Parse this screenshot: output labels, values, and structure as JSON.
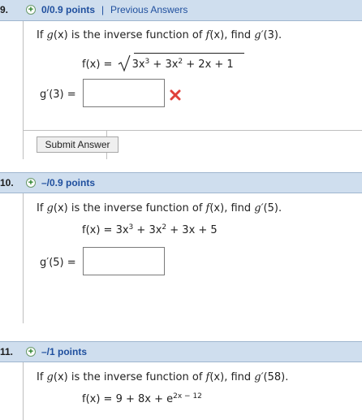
{
  "questions": [
    {
      "number": "9.",
      "points": "0/0.9 points",
      "separator": "|",
      "previous_answers": "Previous Answers",
      "prompt": {
        "pre": "If ",
        "g": "g",
        "x1": "(x)",
        "mid": " is the inverse function of ",
        "f": "f",
        "x2": "(x)",
        "find": ", find ",
        "gp": "g′",
        "arg": "(3)."
      },
      "formula": {
        "lhs": "f(x) = ",
        "t1": "3x",
        "e1": "3",
        "t2": " + 3x",
        "e2": "2",
        "t3": " + 2x + 1"
      },
      "answer_label": "g′(3) =",
      "answer_value": "",
      "status": "incorrect",
      "submit_label": "Submit Answer"
    },
    {
      "number": "10.",
      "points": "–/0.9 points",
      "prompt": {
        "pre": "If ",
        "g": "g",
        "x1": "(x)",
        "mid": " is the inverse function of ",
        "f": "f",
        "x2": "(x)",
        "find": ", find ",
        "gp": "g′",
        "arg": "(5)."
      },
      "formula": {
        "lhs": "f(x) = ",
        "t1": "3x",
        "e1": "3",
        "t2": " + 3x",
        "e2": "2",
        "t3": " + 3x + 5"
      },
      "answer_label": "g′(5) =",
      "answer_value": ""
    },
    {
      "number": "11.",
      "points": "–/1 points",
      "prompt": {
        "pre": "If ",
        "g": "g",
        "x1": "(x)",
        "mid": " is the inverse function of ",
        "f": "f",
        "x2": "(x)",
        "find": ", find ",
        "gp": "g′",
        "arg": "(58)."
      },
      "formula": {
        "lhs": "f(x) = ",
        "t1": "9 + 8x + e",
        "e1": "2x − 12"
      }
    }
  ],
  "colors": {
    "header_bg": "#cfdeee",
    "link": "#1f4f9e",
    "error": "#e0403a"
  },
  "icons": {
    "points_icon": "plus-circle-icon",
    "incorrect_icon": "red-x-icon"
  }
}
